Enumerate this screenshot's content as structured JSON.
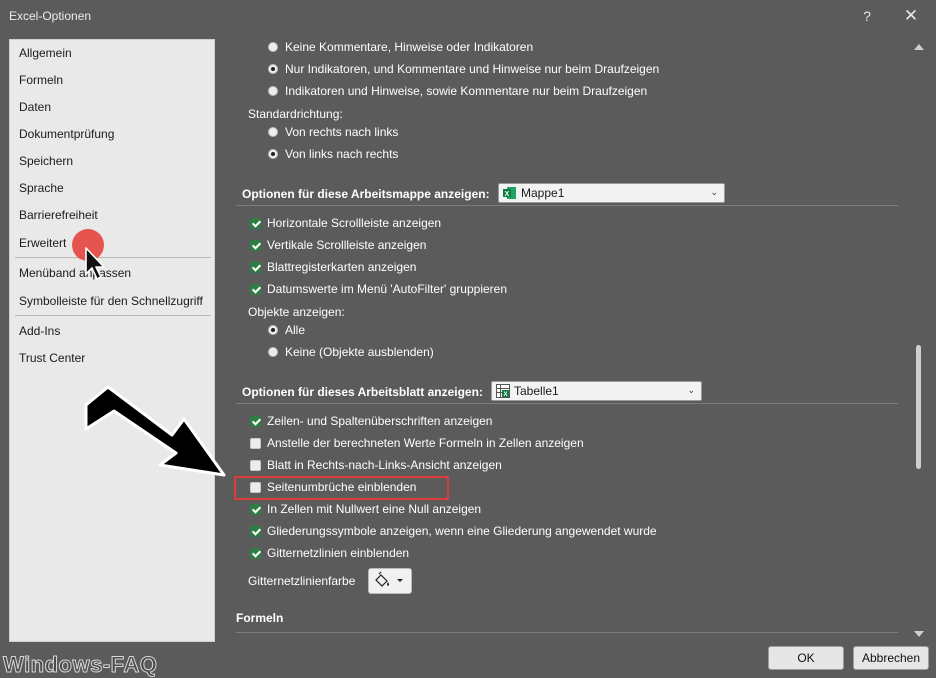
{
  "window": {
    "title": "Excel-Optionen",
    "help": "?",
    "close": "✕"
  },
  "nav": {
    "items": [
      "Allgemein",
      "Formeln",
      "Daten",
      "Dokumentprüfung",
      "Speichern",
      "Sprache",
      "Barrierefreiheit",
      "Erweitert",
      "Menüband anpassen",
      "Symbolleiste für den Schnellzugriff",
      "Add-Ins",
      "Trust Center"
    ],
    "selected": "Erweitert"
  },
  "comments": {
    "options": [
      {
        "label": "Keine Kommentare, Hinweise oder Indikatoren",
        "selected": false
      },
      {
        "label": "Nur Indikatoren, und Kommentare und Hinweise nur beim Draufzeigen",
        "selected": true
      },
      {
        "label": "Indikatoren und Hinweise, sowie Kommentare nur beim Draufzeigen",
        "selected": false
      }
    ]
  },
  "direction": {
    "label": "Standardrichtung:",
    "options": [
      {
        "label": "Von rechts nach links",
        "selected": false
      },
      {
        "label": "Von links nach rechts",
        "selected": true
      }
    ]
  },
  "workbook": {
    "section_label": "Optionen für diese Arbeitsmappe anzeigen:",
    "dropdown_value": "Mappe1",
    "checkboxes": [
      {
        "label": "Horizontale Scrollleiste anzeigen",
        "checked": true
      },
      {
        "label": "Vertikale Scrollleiste anzeigen",
        "checked": true
      },
      {
        "label": "Blattregisterkarten anzeigen",
        "checked": true
      },
      {
        "label": "Datumswerte im Menü 'AutoFilter' gruppieren",
        "checked": true
      }
    ],
    "objects_label": "Objekte anzeigen:",
    "objects": [
      {
        "label": "Alle",
        "selected": true
      },
      {
        "label": "Keine (Objekte ausblenden)",
        "selected": false
      }
    ]
  },
  "worksheet": {
    "section_label": "Optionen für dieses Arbeitsblatt anzeigen:",
    "dropdown_value": "Tabelle1",
    "checkboxes": [
      {
        "label": "Zeilen- und Spaltenüberschriften anzeigen",
        "checked": true
      },
      {
        "label": "Anstelle der berechneten Werte Formeln in Zellen anzeigen",
        "checked": false
      },
      {
        "label": "Blatt in Rechts-nach-Links-Ansicht anzeigen",
        "checked": false
      },
      {
        "label": "Seitenumbrüche einblenden",
        "checked": false
      },
      {
        "label": "In Zellen mit Nullwert eine Null anzeigen",
        "checked": true
      },
      {
        "label": "Gliederungssymbole anzeigen, wenn eine Gliederung angewendet wurde",
        "checked": true
      },
      {
        "label": "Gitternetzlinien einblenden",
        "checked": true
      }
    ],
    "gridcolor_label": "Gitternetzlinienfarbe"
  },
  "formulas_section": "Formeln",
  "buttons": {
    "ok": "OK",
    "cancel": "Abbrechen"
  },
  "watermark": "Windows-FAQ",
  "colors": {
    "window_bg": "#5b5b5b",
    "nav_bg": "#e9e9e9",
    "checkbox_on": "#2e7d42",
    "highlight": "#e03a3a",
    "red_dot": "#e53935"
  }
}
